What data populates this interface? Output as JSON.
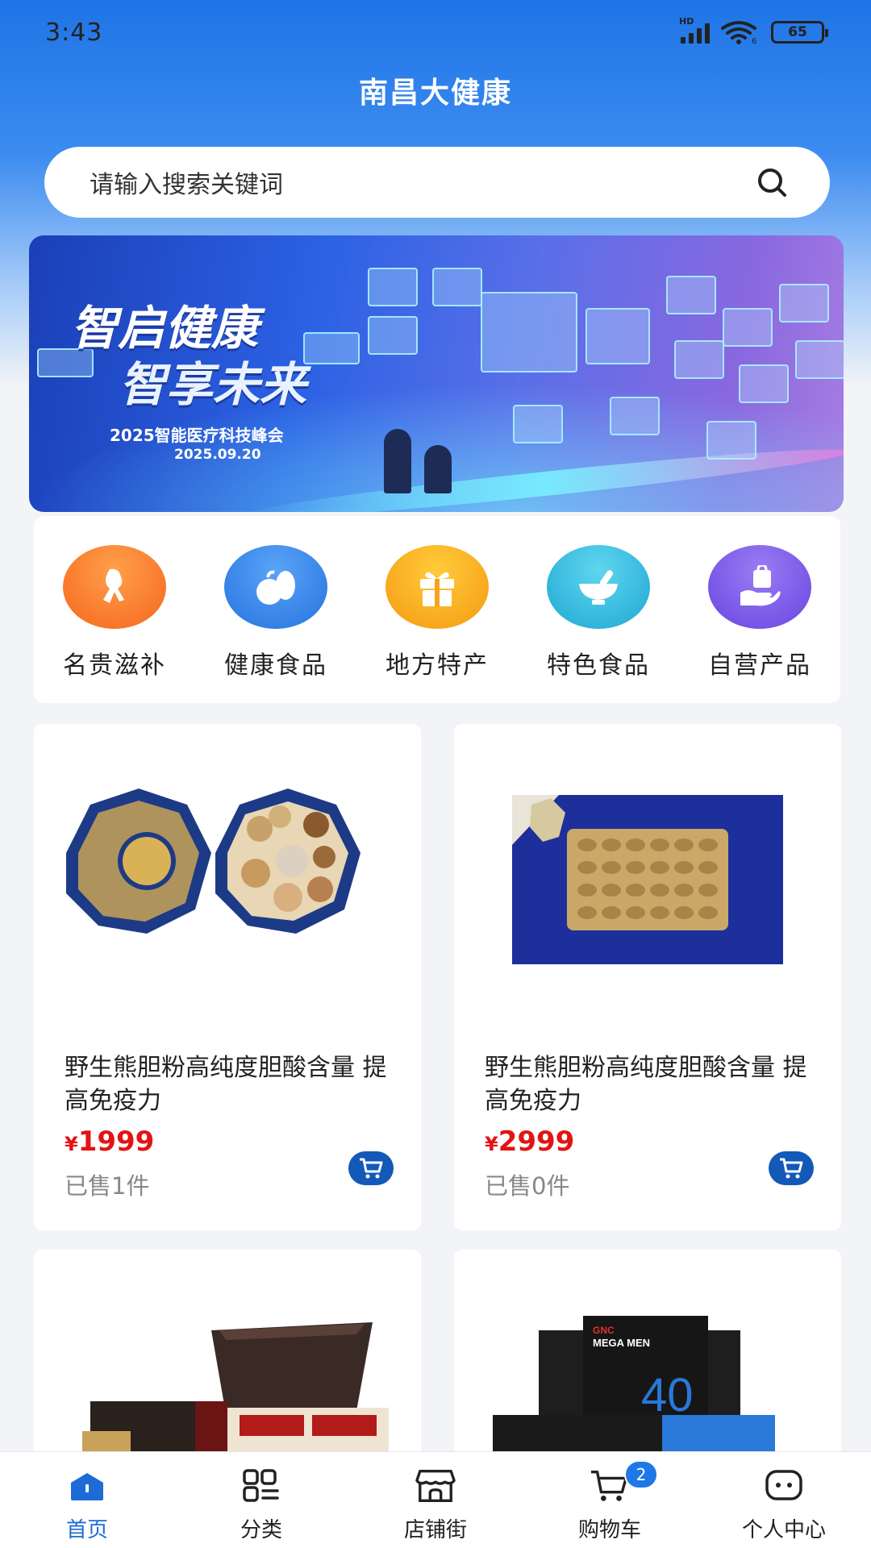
{
  "status_bar": {
    "time": "3:43",
    "battery": "65"
  },
  "header": {
    "title": "南昌大健康"
  },
  "search": {
    "placeholder": "请输入搜索关键词"
  },
  "banner": {
    "headline_1": "智启健康",
    "headline_2": "智享未来",
    "subtitle": "2025智能医疗科技峰会",
    "date": "2025.09.20"
  },
  "categories": [
    {
      "label": "名贵滋补",
      "icon": "ginseng-icon",
      "color": "#f57a2c"
    },
    {
      "label": "健康食品",
      "icon": "vegetables-icon",
      "color": "#2f7fe6"
    },
    {
      "label": "地方特产",
      "icon": "gift-icon",
      "color": "#f7a21b"
    },
    {
      "label": "特色食品",
      "icon": "mortar-icon",
      "color": "#2bb6d8"
    },
    {
      "label": "自营产品",
      "icon": "hand-bag-icon",
      "color": "#7a55e8"
    }
  ],
  "products": [
    {
      "title": "野生熊胆粉高纯度胆酸含量 提高免疫力",
      "currency": "¥",
      "price": "1999",
      "sold": "已售1件"
    },
    {
      "title": "野生熊胆粉高纯度胆酸含量 提高免疫力",
      "currency": "¥",
      "price": "2999",
      "sold": "已售0件"
    },
    {
      "title": "",
      "currency": "",
      "price": "",
      "sold": ""
    },
    {
      "title": "",
      "currency": "",
      "price": "",
      "sold": ""
    }
  ],
  "product_images": {
    "p4_brand": "GNC",
    "p4_name": "MEGA MEN",
    "p4_number": "40"
  },
  "tabbar": {
    "items": [
      {
        "label": "首页",
        "icon": "home-icon",
        "active": true
      },
      {
        "label": "分类",
        "icon": "category-icon"
      },
      {
        "label": "店铺街",
        "icon": "store-icon"
      },
      {
        "label": "购物车",
        "icon": "cart-icon",
        "badge": "2"
      },
      {
        "label": "个人中心",
        "icon": "profile-icon"
      }
    ]
  },
  "colors": {
    "primary": "#1e6bd6",
    "price": "#e31414",
    "cart_button": "#1359b8"
  }
}
